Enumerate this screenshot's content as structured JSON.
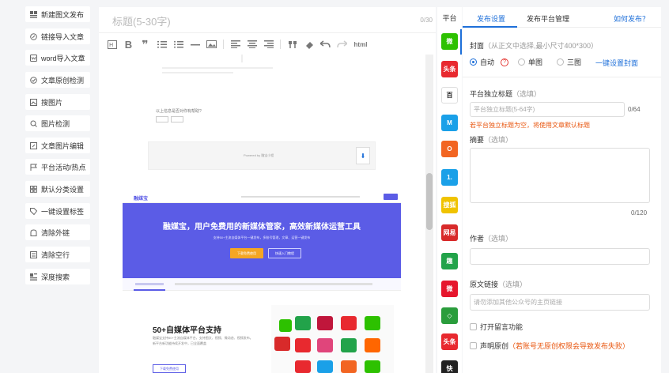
{
  "left_tools": [
    {
      "label": "新建图文发布",
      "icon": "grid-icon"
    },
    {
      "label": "链接导入文章",
      "icon": "link-icon"
    },
    {
      "label": "word导入文章",
      "icon": "word-icon"
    },
    {
      "label": "文章原创检测",
      "icon": "check-circle-icon"
    },
    {
      "label": "搜图片",
      "icon": "image-search-icon"
    },
    {
      "label": "图片检测",
      "icon": "image-check-icon"
    },
    {
      "label": "文章图片编辑",
      "icon": "edit-image-icon"
    },
    {
      "label": "平台活动/热点",
      "icon": "flag-icon"
    },
    {
      "label": "默认分类设置",
      "icon": "category-icon"
    },
    {
      "label": "一键设置标签",
      "icon": "tag-icon"
    },
    {
      "label": "清除外链",
      "icon": "unlink-icon"
    },
    {
      "label": "清除空行",
      "icon": "clear-lines-icon"
    },
    {
      "label": "深度搜索",
      "icon": "deep-search-icon"
    }
  ],
  "editor": {
    "title_placeholder": "标题(5-30字)",
    "title_count": "0/30",
    "toolbar_html": "html",
    "preview": {
      "question": "以上信息是否对你有帮助?",
      "powered": "Powered by 融宝小程",
      "banner_brand": "融媒宝",
      "banner_headline": "融媒宝，用户免费用的新媒体管家，高效新媒体运营工具",
      "banner_sub": "支持50+主流自媒体平台一键发布，多账号管理，文章、运营一键发布",
      "btn_download": "下载免费使用",
      "btn_quick": "快速入门教程",
      "support_title": "50+自媒体平台支持",
      "support_desc1": "融媒宝支持50+主流自媒体平台，支持图文、视频、微动态、视频发布。",
      "support_desc2": "新平台新功能持续开发中，已全面覆盖",
      "support_btn": "下载免费使用"
    }
  },
  "platforms": {
    "header": "平台",
    "items": [
      {
        "name": "wechat-icon",
        "color": "#2dc100",
        "text": "微"
      },
      {
        "name": "toutiao-icon",
        "color": "#e8292f",
        "text": "头条"
      },
      {
        "name": "baijiahao-icon",
        "color": "#ffffff",
        "text": "百"
      },
      {
        "name": "dayu-icon",
        "color": "#1aa0e8",
        "text": "M"
      },
      {
        "name": "sohu-icon",
        "color": "#f26522",
        "text": "O"
      },
      {
        "name": "yidian-icon",
        "color": "#1aa0e8",
        "text": "1."
      },
      {
        "name": "souhu-news-icon",
        "color": "#f0c300",
        "text": "搜狐"
      },
      {
        "name": "wangyi-icon",
        "color": "#d82a2a",
        "text": "网易"
      },
      {
        "name": "qutoutiao-icon",
        "color": "#22a34a",
        "text": "趣"
      },
      {
        "name": "weibo-icon",
        "color": "#e6162d",
        "text": "微"
      },
      {
        "name": "dafeng-icon",
        "color": "#2a9d3c",
        "text": "◇"
      },
      {
        "name": "toutiao2-icon",
        "color": "#e8292f",
        "text": "头条"
      },
      {
        "name": "kuaibao-icon",
        "color": "#222222",
        "text": "快"
      }
    ]
  },
  "settings": {
    "tab_publish": "发布设置",
    "tab_platform": "发布平台管理",
    "how_to": "如何发布？",
    "cover_label": "封面",
    "cover_hint": "（从正文中选择,最小尺寸400*300）",
    "cover_options": [
      "自动",
      "单图",
      "三图"
    ],
    "cover_selected": "自动",
    "cover_quick": "一键设置封面",
    "plat_title_label": "平台独立标题",
    "optional": "（选填）",
    "plat_title_placeholder": "平台独立标题(5-64字)",
    "plat_title_count": "0/64",
    "plat_title_warn": "若平台独立标题为空，将使用文章默认标题",
    "summary_label": "摘要",
    "summary_count": "0/120",
    "author_label": "作者",
    "source_label": "原文链接",
    "source_placeholder": "请勿添加其他公众号的主页链接",
    "comment_label": "打开留言功能",
    "original_label": "声明原创",
    "original_warn": "（若账号无原创权限会导致发布失败）"
  },
  "colors": {
    "accent": "#1e6fd9",
    "warn": "#e8550e",
    "banner": "#5b5ce6",
    "orange_btn": "#f5a623"
  }
}
